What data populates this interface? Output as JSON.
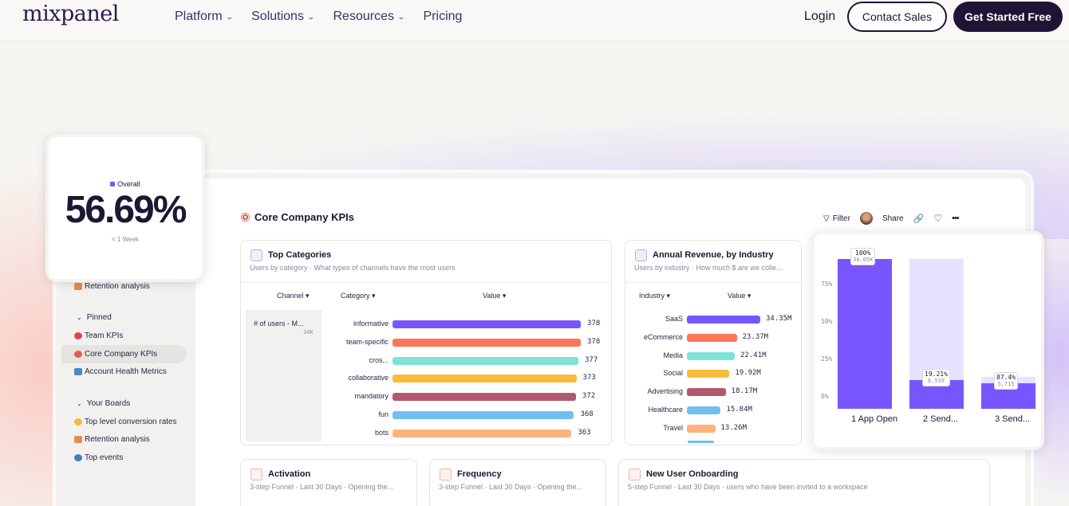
{
  "nav": {
    "logo": "mixpanel",
    "menu": [
      {
        "label": "Platform",
        "has_dropdown": true
      },
      {
        "label": "Solutions",
        "has_dropdown": true
      },
      {
        "label": "Resources",
        "has_dropdown": true
      },
      {
        "label": "Pricing",
        "has_dropdown": false
      }
    ],
    "login": "Login",
    "contact": "Contact Sales",
    "start": "Get Started Free"
  },
  "overall": {
    "label": "Overall",
    "value": "56.69%",
    "period": "< 1 Week"
  },
  "sidebar": {
    "partial_item": "Retention analysis",
    "pinned_label": "Pinned",
    "pinned": [
      "Team KPIs",
      "Core Company KPIs",
      "Account Health Metrics"
    ],
    "boards_label": "Your Boards",
    "boards": [
      "Top level conversion rates",
      "Retention analysis",
      "Top events"
    ]
  },
  "dashboard": {
    "title": "Core Company KPIs",
    "toolbar": {
      "filter": "Filter",
      "share": "Share"
    }
  },
  "top_categories": {
    "title": "Top Categories",
    "subtitle": "Users by category · What types of channels have the most users",
    "col_channel": "Channel",
    "col_category": "Category",
    "col_value": "Value",
    "metric_label": "# of users - M...",
    "metric_total": "24K",
    "rows": [
      {
        "label": "informative",
        "value": "378",
        "color": "#7856ff"
      },
      {
        "label": "team-specific",
        "value": "378",
        "color": "#ff7557"
      },
      {
        "label": "cros...",
        "value": "377",
        "color": "#80e1d9"
      },
      {
        "label": "collaborative",
        "value": "373",
        "color": "#f8bc3b"
      },
      {
        "label": "mandatory",
        "value": "372",
        "color": "#b2596e"
      },
      {
        "label": "fun",
        "value": "368",
        "color": "#72bef4"
      },
      {
        "label": "bots",
        "value": "363",
        "color": "#ffb27a"
      }
    ]
  },
  "annual_revenue": {
    "title": "Annual Revenue, by Industry",
    "subtitle": "Users by industry · How much $ are we colle...",
    "col_industry": "Industry",
    "col_value": "Value",
    "rows": [
      {
        "label": "SaaS",
        "value": "34.35M",
        "color": "#7856ff"
      },
      {
        "label": "eCommerce",
        "value": "23.37M",
        "color": "#ff7557"
      },
      {
        "label": "Media",
        "value": "22.41M",
        "color": "#80e1d9"
      },
      {
        "label": "Social",
        "value": "19.92M",
        "color": "#f8bc3b"
      },
      {
        "label": "Advertising",
        "value": "18.17M",
        "color": "#b2596e"
      },
      {
        "label": "Healthcare",
        "value": "15.84M",
        "color": "#72bef4"
      },
      {
        "label": "Travel",
        "value": "13.26M",
        "color": "#ffb27a"
      }
    ]
  },
  "funnel": {
    "yticks": [
      "75%",
      "50%",
      "25%",
      "0%"
    ],
    "steps": [
      {
        "label": "1 App Open",
        "pct": "100%",
        "count": "34.05K",
        "fraction": 1.0
      },
      {
        "label": "2 Send...",
        "pct": "19.21%",
        "count": "6,539",
        "fraction": 0.1921
      },
      {
        "label": "3 Send...",
        "pct": "87.4%",
        "count": "5,715",
        "fraction": 0.168
      }
    ]
  },
  "bottom_cards": [
    {
      "title": "Activation",
      "subtitle": "3-step Funnel · Last 30 Days · Opening the..."
    },
    {
      "title": "Frequency",
      "subtitle": "3-step Funnel · Last 30 Days · Opening the..."
    },
    {
      "title": "New User Onboarding",
      "subtitle": "5-step Funnel · Last 30 Days · users who have been invited to a workspace"
    }
  ]
}
